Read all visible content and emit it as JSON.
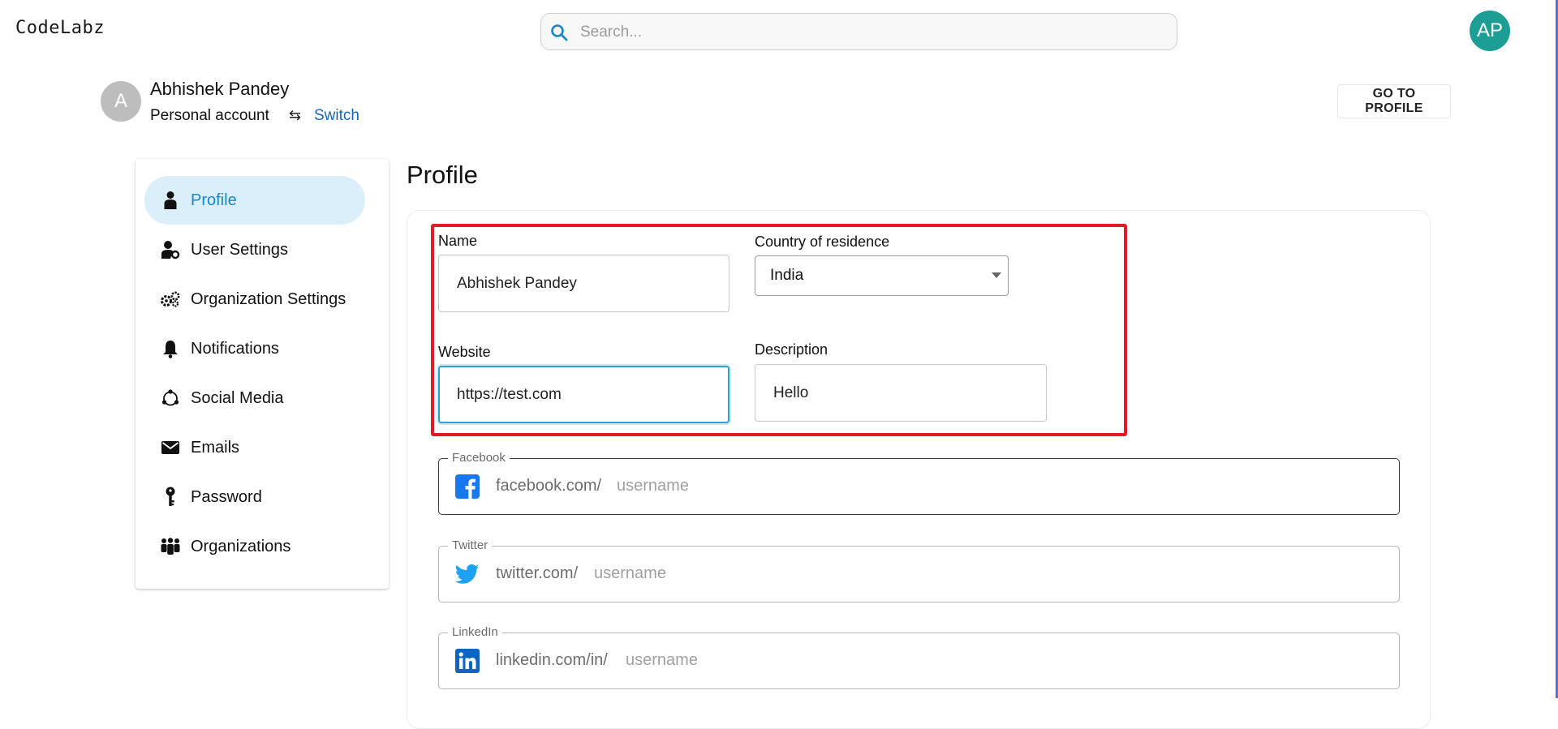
{
  "header": {
    "logo": "CodeLabz",
    "search_placeholder": "Search...",
    "user_initials": "AP"
  },
  "account": {
    "initial": "A",
    "name": "Abhishek Pandey",
    "type": "Personal account",
    "switch_icon": "⇆",
    "switch_label": "Switch",
    "goto_profile": "GO TO PROFILE"
  },
  "sidebar": {
    "items": [
      {
        "label": "Profile",
        "icon": "person-icon",
        "active": true
      },
      {
        "label": "User Settings",
        "icon": "user-settings-icon"
      },
      {
        "label": "Organization Settings",
        "icon": "gears-icon"
      },
      {
        "label": "Notifications",
        "icon": "bell-icon"
      },
      {
        "label": "Social Media",
        "icon": "social-icon"
      },
      {
        "label": "Emails",
        "icon": "envelope-icon"
      },
      {
        "label": "Password",
        "icon": "key-icon"
      },
      {
        "label": "Organizations",
        "icon": "group-icon"
      }
    ]
  },
  "profile": {
    "title": "Profile",
    "name_label": "Name",
    "name_value": "Abhishek Pandey",
    "country_label": "Country of residence",
    "country_value": "India",
    "website_label": "Website",
    "website_value": "https://test.com",
    "description_label": "Description",
    "description_value": "Hello"
  },
  "social": {
    "facebook": {
      "label": "Facebook",
      "prefix": "facebook.com/",
      "placeholder": "username",
      "color": "#1877f2"
    },
    "twitter": {
      "label": "Twitter",
      "prefix": "twitter.com/",
      "placeholder": "username",
      "color": "#1da1f2"
    },
    "linkedin": {
      "label": "LinkedIn",
      "prefix": "linkedin.com/in/",
      "placeholder": "username",
      "color": "#0a66c2"
    }
  },
  "colors": {
    "accent": "#1a86c8",
    "highlight": "#e11d24",
    "avatar": "#1c9e95"
  }
}
